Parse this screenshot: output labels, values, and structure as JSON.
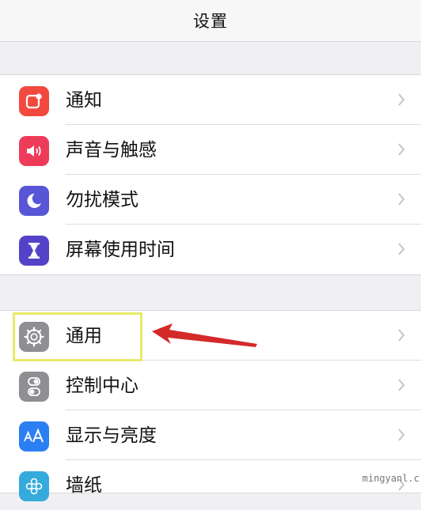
{
  "nav": {
    "title": "设置"
  },
  "group1": [
    {
      "label": "通知",
      "icon": "notifications-icon",
      "color": "#f2493f"
    },
    {
      "label": "声音与触感",
      "icon": "speaker-icon",
      "color": "#ef3b5a"
    },
    {
      "label": "勿扰模式",
      "icon": "moon-icon",
      "color": "#5856d6"
    },
    {
      "label": "屏幕使用时间",
      "icon": "hourglass-icon",
      "color": "#5443c9"
    }
  ],
  "group2": [
    {
      "label": "通用",
      "icon": "gear-icon",
      "color": "#8e8e93"
    },
    {
      "label": "控制中心",
      "icon": "toggles-icon",
      "color": "#8e8e93"
    },
    {
      "label": "显示与亮度",
      "icon": "text-size-icon",
      "color": "#2b7ff2"
    },
    {
      "label": "墙纸",
      "icon": "flower-icon",
      "color": "#35aadc"
    }
  ],
  "annotation": {
    "highlight_color": "#e8ea6a",
    "arrow_color": "#d42a2a"
  },
  "watermark": "mingyanl.c"
}
